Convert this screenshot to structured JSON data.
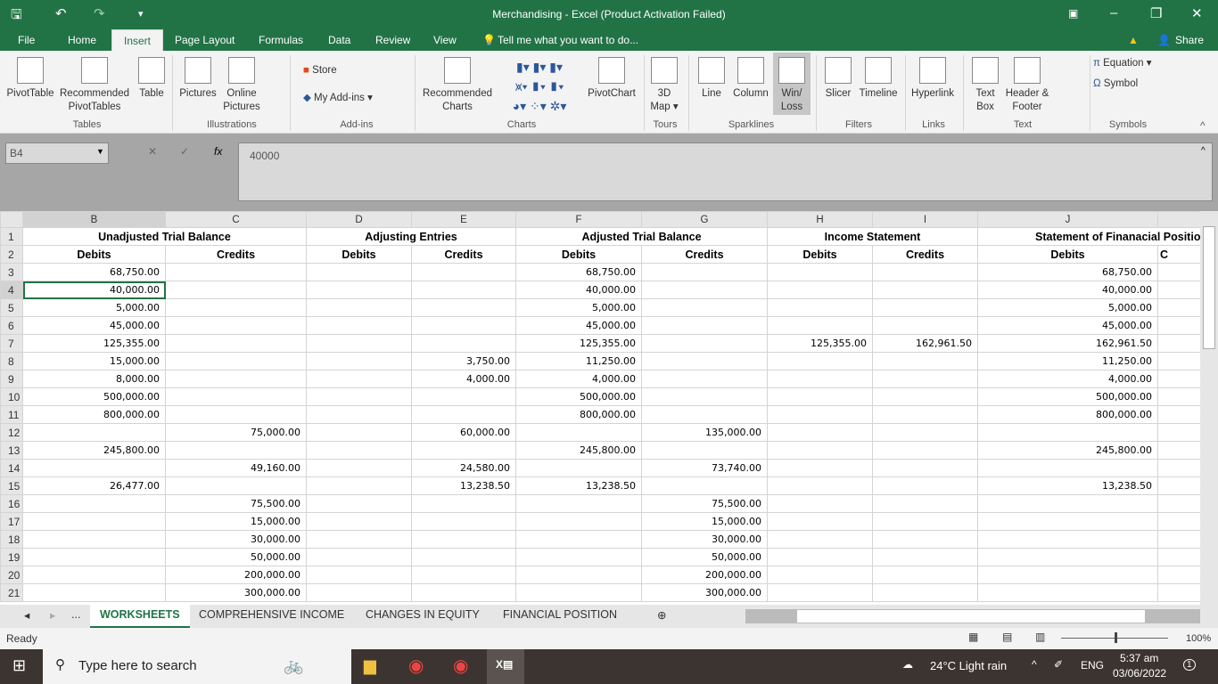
{
  "title": "Merchandising - Excel (Product Activation Failed)",
  "menu": [
    "File",
    "Home",
    "Insert",
    "Page Layout",
    "Formulas",
    "Data",
    "Review",
    "View"
  ],
  "tell_me": "Tell me what you want to do...",
  "share": "Share",
  "ribbon": {
    "buttons": [
      "PivotTable",
      "Recommended PivotTables",
      "Table",
      "Pictures",
      "Online Pictures",
      "Store",
      "My Add-ins",
      "Recommended Charts",
      "PivotChart",
      "3D Map",
      "Line",
      "Column",
      "Win/ Loss",
      "Slicer",
      "Timeline",
      "Hyperlink",
      "Text Box",
      "Header & Footer",
      "Equation",
      "Symbol"
    ],
    "groups": [
      "Tables",
      "Illustrations",
      "Add-ins",
      "Charts",
      "Tours",
      "Sparklines",
      "Filters",
      "Links",
      "Text",
      "Symbols"
    ]
  },
  "name_box": "B4",
  "formula": "40000",
  "columns": [
    "B",
    "C",
    "D",
    "E",
    "F",
    "G",
    "H",
    "I",
    "J"
  ],
  "headers": [
    "Unadjusted Trial Balance",
    "Adjusting Entries",
    "Adjusted Trial Balance",
    "Income Statement",
    "Statement of Finanacial Position"
  ],
  "subheaders": [
    "Debits",
    "Credits",
    "Debits",
    "Credits",
    "Debits",
    "Credits",
    "Debits",
    "Credits",
    "Debits",
    "C"
  ],
  "rows": [
    {
      "n": "3",
      "B": "68,750.00",
      "F": "68,750.00",
      "J": "68,750.00"
    },
    {
      "n": "4",
      "B": "40,000.00",
      "F": "40,000.00",
      "J": "40,000.00"
    },
    {
      "n": "5",
      "B": "5,000.00",
      "F": "5,000.00",
      "J": "5,000.00"
    },
    {
      "n": "6",
      "B": "45,000.00",
      "F": "45,000.00",
      "J": "45,000.00"
    },
    {
      "n": "7",
      "B": "125,355.00",
      "F": "125,355.00",
      "H": "125,355.00",
      "I": "162,961.50",
      "J": "162,961.50"
    },
    {
      "n": "8",
      "B": "15,000.00",
      "E": "3,750.00",
      "F": "11,250.00",
      "J": "11,250.00"
    },
    {
      "n": "9",
      "B": "8,000.00",
      "E": "4,000.00",
      "F": "4,000.00",
      "J": "4,000.00"
    },
    {
      "n": "10",
      "B": "500,000.00",
      "F": "500,000.00",
      "J": "500,000.00"
    },
    {
      "n": "11",
      "B": "800,000.00",
      "F": "800,000.00",
      "J": "800,000.00"
    },
    {
      "n": "12",
      "C": "75,000.00",
      "E": "60,000.00",
      "G": "135,000.00"
    },
    {
      "n": "13",
      "B": "245,800.00",
      "F": "245,800.00",
      "J": "245,800.00"
    },
    {
      "n": "14",
      "C": "49,160.00",
      "E": "24,580.00",
      "G": "73,740.00"
    },
    {
      "n": "15",
      "B": "26,477.00",
      "E": "13,238.50",
      "F": "13,238.50",
      "J": "13,238.50"
    },
    {
      "n": "16",
      "C": "75,500.00",
      "G": "75,500.00"
    },
    {
      "n": "17",
      "C": "15,000.00",
      "G": "15,000.00"
    },
    {
      "n": "18",
      "C": "30,000.00",
      "G": "30,000.00"
    },
    {
      "n": "19",
      "C": "50,000.00",
      "G": "50,000.00"
    },
    {
      "n": "20",
      "C": "200,000.00",
      "G": "200,000.00"
    },
    {
      "n": "21",
      "C": "300,000.00",
      "G": "300,000.00"
    }
  ],
  "sheets": [
    "WORKSHEETS",
    "COMPREHENSIVE INCOME",
    "CHANGES IN EQUITY",
    "FINANCIAL POSITION"
  ],
  "ellipsis": "...",
  "status": "Ready",
  "zoom": "100%",
  "taskbar": {
    "search": "Type here to search",
    "weather": "24°C  Light rain",
    "lang": "ENG",
    "time": "5:37 am",
    "date": "03/06/2022",
    "notif": "1"
  }
}
